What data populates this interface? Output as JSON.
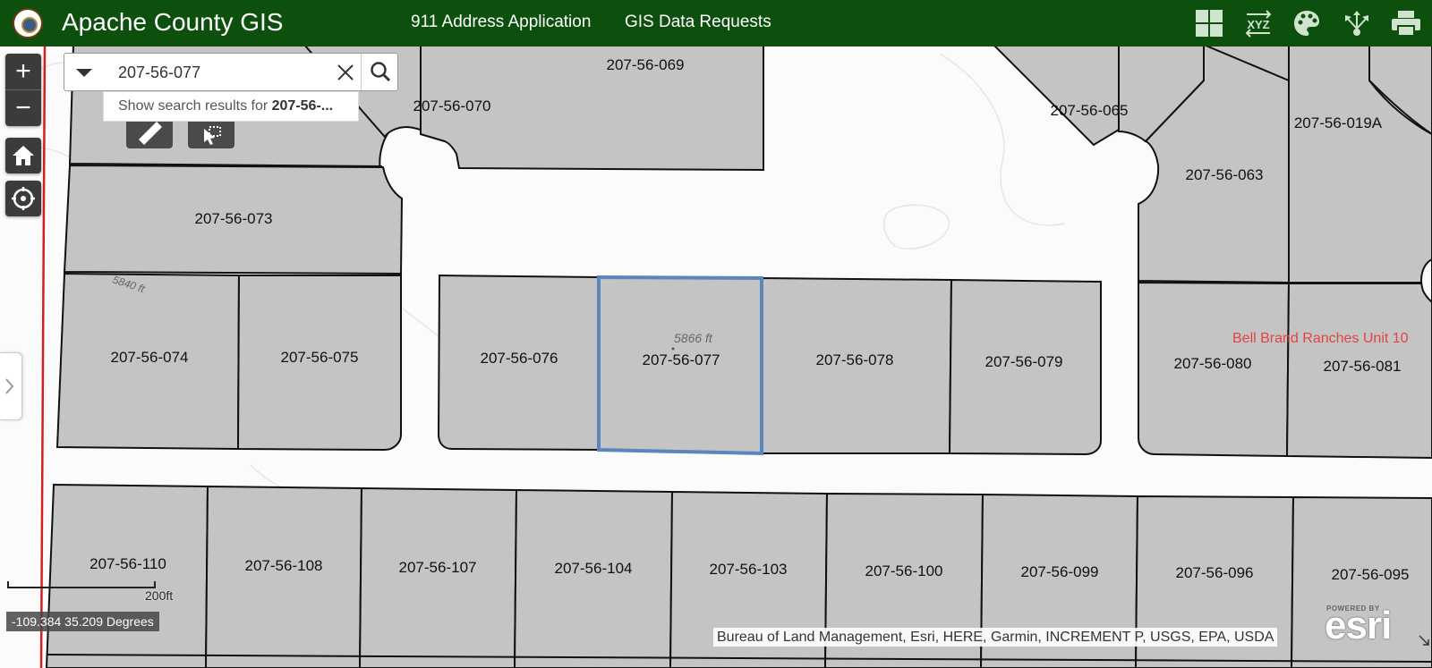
{
  "header": {
    "title": "Apache County GIS",
    "links": [
      "911 Address Application",
      "GIS Data Requests"
    ],
    "tools": [
      "basemap-gallery-icon",
      "xyz-coordinates-icon",
      "layer-styles-icon",
      "share-icon",
      "print-icon"
    ],
    "tool_label_xyz": "XYZ",
    "background_color": "#0d4f0d"
  },
  "search": {
    "value": "207-56-077",
    "suggestion_prefix": "Show search results for ",
    "suggestion_term": "207-56-..."
  },
  "map": {
    "parcels": [
      "207-56-069",
      "207-56-070",
      "207-56-065",
      "207-56-019A",
      "207-56-063",
      "207-56-073",
      "207-56-074",
      "207-56-075",
      "207-56-076",
      "207-56-077",
      "207-56-078",
      "207-56-079",
      "207-56-080",
      "207-56-081",
      "207-56-110",
      "207-56-108",
      "207-56-107",
      "207-56-104",
      "207-56-103",
      "207-56-100",
      "207-56-099",
      "207-56-096",
      "207-56-095"
    ],
    "selected_parcel": "207-56-077",
    "contour_labels": [
      "5840 ft",
      "5866 ft"
    ],
    "subdivision_label": "Bell Brand Ranches Unit 10",
    "parcel_fill": "#c4c4c4",
    "selection_color": "#5b86bd",
    "boundary_color": "#d22020"
  },
  "scalebar": {
    "label": "200ft"
  },
  "coordinates": "-109.384 35.209 Degrees",
  "attribution": "Bureau of Land Management, Esri, HERE, Garmin, INCREMENT P, USGS, EPA, USDA",
  "esri": {
    "powered_by": "POWERED BY",
    "logo_text": "esri"
  }
}
